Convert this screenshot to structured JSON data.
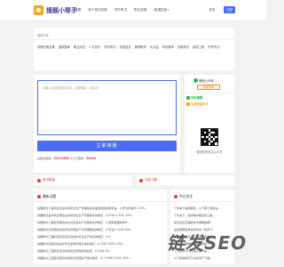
{
  "nav": {
    "logo_text": "搜题小帮手",
    "menu": [
      "搜题",
      "拿个测试答案",
      "学历考试",
      "职业资格",
      "就课答案"
    ],
    "login": "登录",
    "register": "注册"
  },
  "breadcrumb": {
    "home": "题库分类",
    "tags": [
      "就课答案全集",
      "国家题库",
      "职业测试",
      "人文历史",
      "学历考试",
      "技能鉴定",
      "微博教育",
      "大认证",
      "商所教育",
      "资格考试",
      "建筑工程",
      "外贸专业"
    ]
  },
  "search": {
    "placeholder": "请输入或粘贴题目内容，仅限题库，仅供用",
    "button": "立即搜题",
    "stats_label1": "总题目数量：",
    "stats_total": "50112686",
    "stats_label2": "今日已更新：",
    "stats_today": "33034"
  },
  "side": {
    "title": "微信公众号",
    "button": "搜索答案",
    "badge1": "扫码搜题",
    "badge2": "找答案请关注",
    "caption": "微信扫码关注公众号"
  },
  "tabs": {
    "left": "考试指南",
    "right": "试卷习题"
  },
  "latest": {
    "title": "最新试题",
    "rows": [
      "我国重点工程项目建设中的安全生产管理体系和监督措施的规定是，A.安全管理与C.10%...",
      "我国重点基本项目需建设中的安全生产管理体系的规定，A.2%B.2.5%C.10%...",
      "我国重点工程项目需建设中对安全生产管理体系的规定，A.国家监理机构B...",
      "我国重点项目需建设的安全管理生产中管理制度的规定，A.安全C.1%D.10%...",
      "我国重点工程的项目建设与建造中安全生产体系的规定，A.V...",
      "我国重点项目的建设中安全监督管理与体系规定，A.1%B.10%C.10%...",
      "我国重点工程项目建设中的安全管理实施规定，A.1%B.3%...",
      "我国重点工程建设项目中的安全管理生产体系规定，A.1.2%B.2.5%C.10%..."
    ]
  },
  "today": {
    "title": "今日关注",
    "rows": [
      "下列关于基础规定，以下哪个选项是...",
      "下列关于...完成保护相当的工程...",
      "如何设置正确的技术规程数据？",
      "设置保障型单位的状态（完成下）",
      "学术课题研究与...测试试题中...",
      "出现下...哪种情况需要提前...",
      "下列选项可以发展正确的是...",
      "以下哪些情况不适合用于下面..."
    ]
  },
  "watermark": "链发SEO"
}
